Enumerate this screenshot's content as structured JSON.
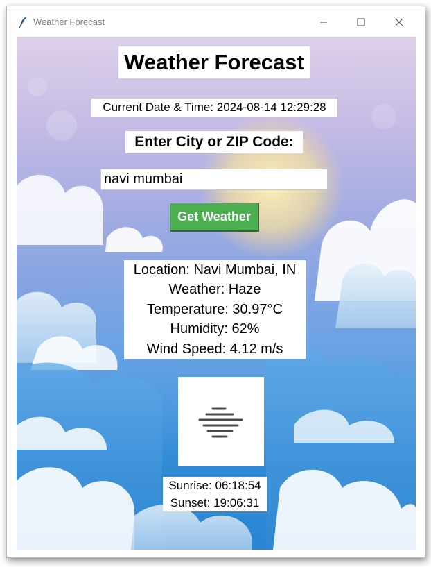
{
  "window": {
    "title": "Weather Forecast"
  },
  "app": {
    "title": "Weather Forecast",
    "datetime": "Current Date & Time: 2024-08-14 12:29:28",
    "prompt": "Enter City or ZIP Code:",
    "city_input_value": "navi mumbai",
    "get_weather_label": "Get Weather",
    "get_weather_color": "#4caf50"
  },
  "weather": {
    "location": "Location: Navi Mumbai, IN",
    "condition": "Weather: Haze",
    "temperature": "Temperature: 30.97°C",
    "humidity": "Humidity: 62%",
    "wind": "Wind Speed: 4.12 m/s",
    "icon": "haze-icon"
  },
  "sun": {
    "sunrise": "Sunrise: 06:18:54",
    "sunset": "Sunset: 19:06:31"
  }
}
